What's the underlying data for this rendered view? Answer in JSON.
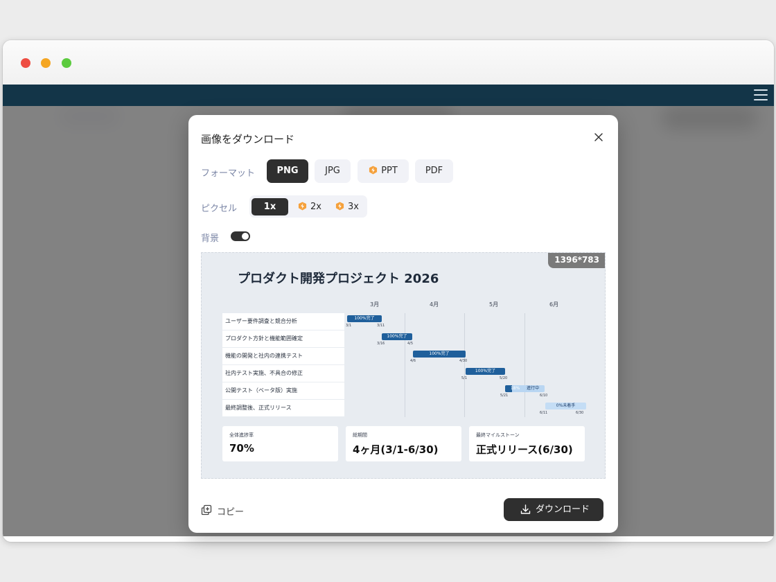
{
  "dialog": {
    "title": "画像をダウンロード",
    "format_label": "フォーマット",
    "formats": [
      "PNG",
      "JPG",
      "PPT",
      "PDF"
    ],
    "selected_format": "PNG",
    "pixel_label": "ピクセル",
    "pixels": [
      "1x",
      "2x",
      "3x"
    ],
    "selected_pixel": "1x",
    "background_label": "背景",
    "background_on": true,
    "copy_label": "コピー",
    "download_label": "ダウンロード"
  },
  "preview": {
    "dimensions": "1396*783",
    "title": "プロダクト開発プロジェクト 2026",
    "months": [
      "3月",
      "4月",
      "5月",
      "6月"
    ],
    "tasks": [
      {
        "name": "ユーザー要件調査と競合分析",
        "status": "100%完了",
        "start": "3/1",
        "end": "3/11",
        "progress": 100
      },
      {
        "name": "プロダクト方針と機能範囲確定",
        "status": "100%完了",
        "start": "3/16",
        "end": "4/5",
        "progress": 100
      },
      {
        "name": "機能の開発と社内の連携テスト",
        "status": "100%完了",
        "start": "4/6",
        "end": "4/30",
        "progress": 100
      },
      {
        "name": "社内テスト実施、不具合の修正",
        "status": "100%完了",
        "start": "5/1",
        "end": "5/20",
        "progress": 100
      },
      {
        "name": "公開テスト（ベータ版）実施",
        "status": "18%",
        "status_extra": "進行中",
        "start": "5/21",
        "end": "6/10",
        "progress": 18
      },
      {
        "name": "最終調整後、正式リリース",
        "status": "0%未着手",
        "start": "6/11",
        "end": "6/30",
        "progress": 0
      }
    ],
    "cards": [
      {
        "label": "全体進捗率",
        "value": "70%"
      },
      {
        "label": "総期間",
        "value": "4ヶ月(3/1-6/30)"
      },
      {
        "label": "最終マイルストーン",
        "value": "正式リリース(6/30)"
      }
    ]
  },
  "colors": {
    "appbar": "#133548",
    "primary_button": "#2f2f2f",
    "bar_done": "#1f5f9b",
    "bar_pending": "#c4ddf5",
    "label_color": "#7b86a6"
  }
}
